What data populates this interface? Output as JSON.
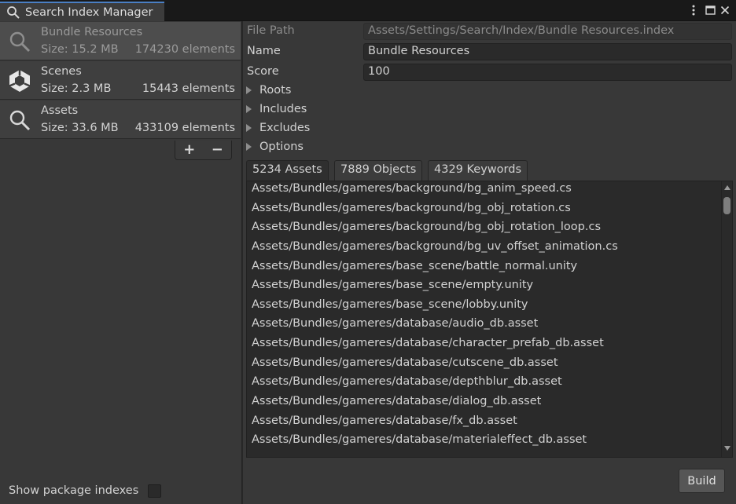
{
  "window": {
    "tab_title": "Search Index Manager",
    "menu_icon": "kebab-menu-icon",
    "maximize_icon": "maximize-icon",
    "close_icon": "close-icon"
  },
  "indexes": [
    {
      "name": "Bundle Resources",
      "size": "Size: 15.2 MB",
      "count": "174230 elements",
      "icon": "search-icon",
      "selected": true
    },
    {
      "name": "Scenes",
      "size": "Size: 2.3 MB",
      "count": "15443 elements",
      "icon": "unity-logo-icon",
      "selected": false
    },
    {
      "name": "Assets",
      "size": "Size: 33.6 MB",
      "count": "433109 elements",
      "icon": "search-icon",
      "selected": false
    }
  ],
  "list_controls": {
    "add": "+",
    "remove": "−"
  },
  "show_package_label": "Show package indexes",
  "properties": {
    "file_path_label": "File Path",
    "file_path_value": "Assets/Settings/Search/Index/Bundle Resources.index",
    "name_label": "Name",
    "name_value": "Bundle Resources",
    "score_label": "Score",
    "score_value": "100"
  },
  "foldouts": [
    "Roots",
    "Includes",
    "Excludes",
    "Options"
  ],
  "result_tabs": [
    "5234 Assets",
    "7889 Objects",
    "4329 Keywords"
  ],
  "assets": [
    "Assets/Bundles/gameres/background/bg_anim_speed.cs",
    "Assets/Bundles/gameres/background/bg_obj_rotation.cs",
    "Assets/Bundles/gameres/background/bg_obj_rotation_loop.cs",
    "Assets/Bundles/gameres/background/bg_uv_offset_animation.cs",
    "Assets/Bundles/gameres/base_scene/battle_normal.unity",
    "Assets/Bundles/gameres/base_scene/empty.unity",
    "Assets/Bundles/gameres/base_scene/lobby.unity",
    "Assets/Bundles/gameres/database/audio_db.asset",
    "Assets/Bundles/gameres/database/character_prefab_db.asset",
    "Assets/Bundles/gameres/database/cutscene_db.asset",
    "Assets/Bundles/gameres/database/depthblur_db.asset",
    "Assets/Bundles/gameres/database/dialog_db.asset",
    "Assets/Bundles/gameres/database/fx_db.asset",
    "Assets/Bundles/gameres/database/materialeffect_db.asset"
  ],
  "build_label": "Build"
}
